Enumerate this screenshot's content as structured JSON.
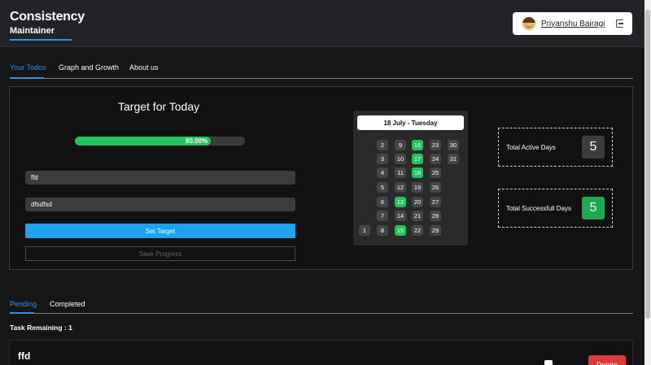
{
  "header": {
    "brand_title": "Consistency",
    "brand_subtitle": "Maintainer",
    "user_name": "Priyanshu Bairagi"
  },
  "tabs": [
    {
      "label": "Your Todos",
      "active": true
    },
    {
      "label": "Graph and Growth",
      "active": false
    },
    {
      "label": "About us",
      "active": false
    }
  ],
  "target": {
    "title": "Target for Today",
    "progress_label": "80.00%",
    "progress_fraction": 0.8,
    "field1_value": "ffd",
    "field2_value": "dfsdfsd",
    "set_button": "Set Target",
    "save_button": "Save Progress"
  },
  "calendar": {
    "header": "18 July - Tuesday",
    "columns": [
      [
        null,
        null,
        null,
        null,
        null,
        null,
        "1"
      ],
      [
        "2",
        "3",
        "4",
        "5",
        "6",
        "7",
        "8"
      ],
      [
        "9",
        "10",
        "11",
        "12",
        "13",
        "14",
        "15"
      ],
      [
        "16",
        "17",
        "18",
        "19",
        "20",
        "21",
        "22"
      ],
      [
        "23",
        "24",
        "25",
        "26",
        "27",
        "28",
        "29"
      ],
      [
        "30",
        "31",
        null,
        null,
        null,
        null,
        null
      ]
    ],
    "green_days": [
      "13",
      "15",
      "16",
      "17",
      "18"
    ]
  },
  "stats": {
    "active_label": "Total Active Days",
    "active_value": "5",
    "success_label": "Total Successfull Days",
    "success_value": "5"
  },
  "subtabs": [
    {
      "label": "Pending",
      "active": true
    },
    {
      "label": "Completed",
      "active": false
    }
  ],
  "tasks": {
    "remaining": "Task Remaining : 1",
    "items": [
      {
        "title": "ffd",
        "delete_label": "Delete"
      }
    ]
  },
  "colors": {
    "accent": "#2f8ff0",
    "success": "#22c35e",
    "danger": "#dc3a3a",
    "button_blue": "#1ea2ef"
  }
}
